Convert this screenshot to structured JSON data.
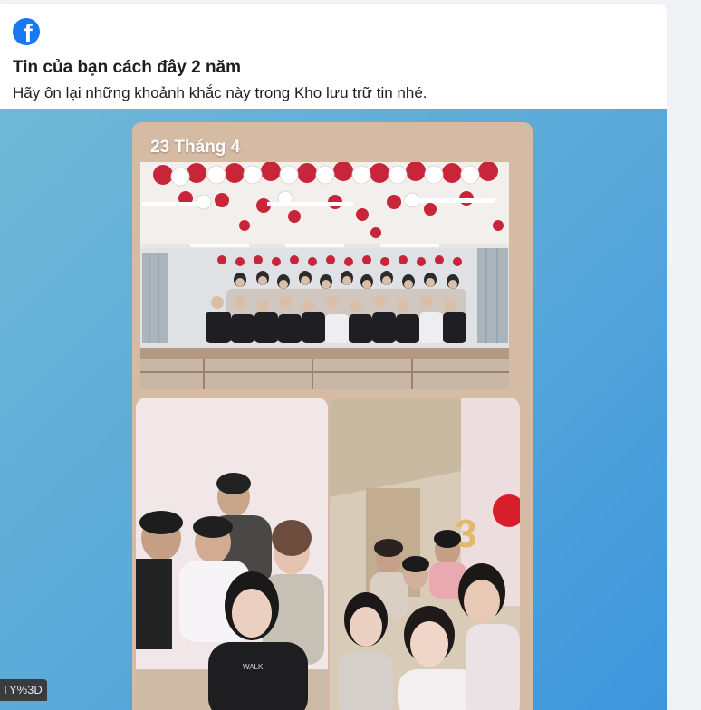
{
  "memory_card": {
    "title": "Tin của bạn cách đây 2 năm",
    "subtitle": "Hãy ôn lại những khoảnh khắc này trong Kho lưu trữ tin nhé.",
    "logo_letter": "f"
  },
  "story": {
    "date_label": "23 Tháng 4",
    "photos": [
      {
        "name": "group-photo-classroom"
      },
      {
        "name": "selfie-photo-left"
      },
      {
        "name": "selfie-photo-right"
      }
    ]
  },
  "status_bar": {
    "url_fragment": "TY%3D"
  },
  "colors": {
    "brand": "#1877f2",
    "background_gradient_start": "#6fb8d6",
    "background_gradient_end": "#3d96dc",
    "balloon_red": "#c8243a"
  },
  "icons": [
    "facebook-logo-icon"
  ]
}
